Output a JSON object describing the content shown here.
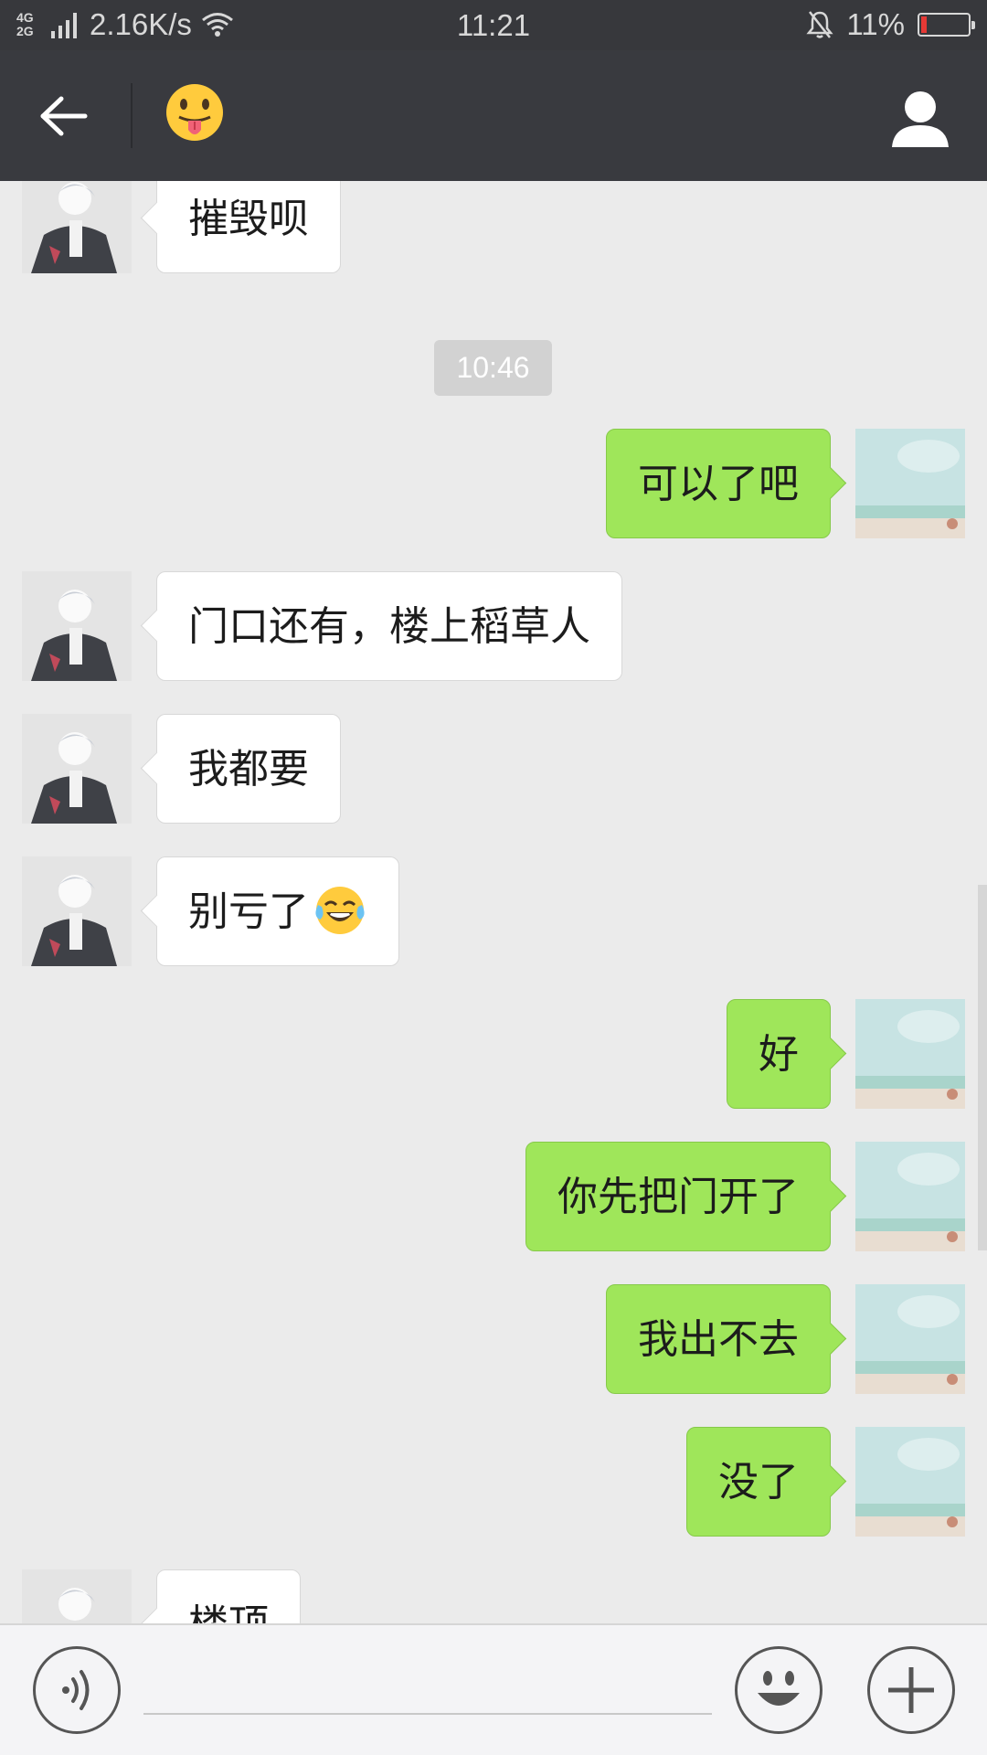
{
  "status_bar": {
    "net_type_top": "4G",
    "net_type_bottom": "2G",
    "speed": "2.16K/s",
    "time": "11:21",
    "battery": "11%",
    "battery_level": 0.11
  },
  "header": {
    "back_icon": "arrow-left-icon",
    "title": "😛",
    "profile_icon": "person-icon"
  },
  "chat": {
    "timestamp": "10:46",
    "messages": [
      {
        "side": "in",
        "text": "摧毁呗"
      },
      {
        "side": "out",
        "text": "可以了吧"
      },
      {
        "side": "in",
        "text": "门口还有，楼上稻草人"
      },
      {
        "side": "in",
        "text": "我都要"
      },
      {
        "side": "in",
        "text": "别亏了",
        "emoji": "tears-of-joy-emoji"
      },
      {
        "side": "out",
        "text": "好"
      },
      {
        "side": "out",
        "text": "你先把门开了"
      },
      {
        "side": "out",
        "text": "我出不去"
      },
      {
        "side": "out",
        "text": "没了"
      },
      {
        "side": "in",
        "text": "楼顶"
      }
    ]
  },
  "input_bar": {
    "voice_icon": "voice-icon",
    "emoji_icon": "smiley-icon",
    "plus_icon": "plus-icon",
    "input_value": ""
  },
  "colors": {
    "outgoing_bubble": "#9fe65a",
    "incoming_bubble": "#ffffff",
    "header_bg": "#393a3f",
    "chat_bg": "#ebebeb"
  }
}
